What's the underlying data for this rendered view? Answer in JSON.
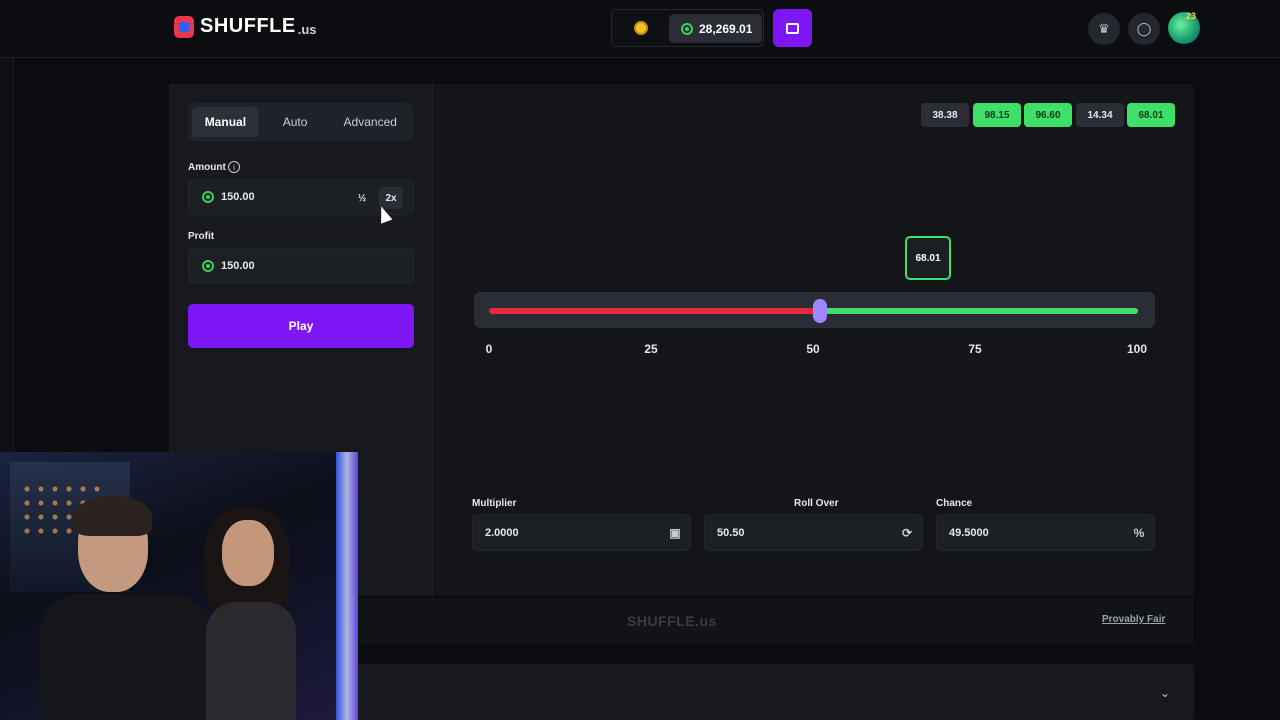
{
  "header": {
    "logo_text": "SHUFFLE",
    "logo_tld": ".us",
    "balance": "28,269.01"
  },
  "controls": {
    "tabs": [
      "Manual",
      "Auto",
      "Advanced"
    ],
    "active_tab": "Manual",
    "amount_label": "Amount",
    "amount_value": "150.00",
    "half_label": "½",
    "double_label": "2x",
    "profit_label": "Profit",
    "profit_value": "150.00",
    "play_label": "Play"
  },
  "history": [
    {
      "value": "38.38",
      "win": false
    },
    {
      "value": "98.15",
      "win": true
    },
    {
      "value": "96.60",
      "win": true
    },
    {
      "value": "14.34",
      "win": false
    },
    {
      "value": "68.01",
      "win": true
    }
  ],
  "slider": {
    "result": "68.01",
    "threshold": 50.5,
    "ticks": [
      "0",
      "25",
      "50",
      "75",
      "100"
    ]
  },
  "bottom": {
    "multiplier_label": "Multiplier",
    "multiplier_value": "2.0000",
    "rollover_label": "Roll Over",
    "rollover_value": "50.50",
    "chance_label": "Chance",
    "chance_value": "49.5000",
    "chance_unit": "%"
  },
  "footer": {
    "logo_text": "SHUFFLE.us",
    "provably_fair": "Provably Fair"
  },
  "colors": {
    "accent": "#7c16f5",
    "win": "#3ee06a",
    "lose": "#e8283f"
  }
}
